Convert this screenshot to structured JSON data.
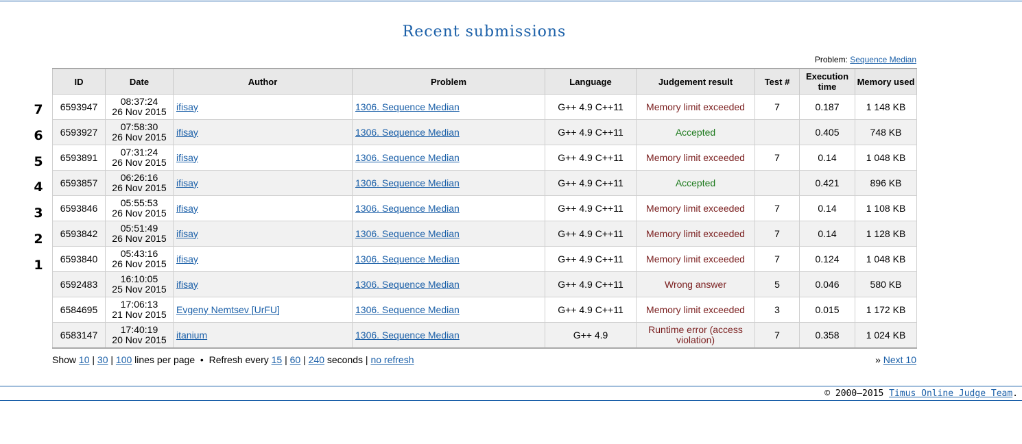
{
  "title": "Recent submissions",
  "problem_filter": {
    "label": "Problem:",
    "link": "Sequence Median"
  },
  "columns": [
    "ID",
    "Date",
    "Author",
    "Problem",
    "Language",
    "Judgement result",
    "Test #",
    "Execution time",
    "Memory used"
  ],
  "rows": [
    {
      "annot": "7",
      "id": "6593947",
      "time": "08:37:24",
      "date": "26 Nov 2015",
      "author": "ifisay",
      "problem": "1306. Sequence Median",
      "language": "G++ 4.9 C++11",
      "result": "Memory limit exceeded",
      "result_type": "mle",
      "test": "7",
      "exec": "0.187",
      "memory": "1 148 KB"
    },
    {
      "annot": "6",
      "id": "6593927",
      "time": "07:58:30",
      "date": "26 Nov 2015",
      "author": "ifisay",
      "problem": "1306. Sequence Median",
      "language": "G++ 4.9 C++11",
      "result": "Accepted",
      "result_type": "ac",
      "test": "",
      "exec": "0.405",
      "memory": "748 KB"
    },
    {
      "annot": "5",
      "id": "6593891",
      "time": "07:31:24",
      "date": "26 Nov 2015",
      "author": "ifisay",
      "problem": "1306. Sequence Median",
      "language": "G++ 4.9 C++11",
      "result": "Memory limit exceeded",
      "result_type": "mle",
      "test": "7",
      "exec": "0.14",
      "memory": "1 048 KB"
    },
    {
      "annot": "4",
      "id": "6593857",
      "time": "06:26:16",
      "date": "26 Nov 2015",
      "author": "ifisay",
      "problem": "1306. Sequence Median",
      "language": "G++ 4.9 C++11",
      "result": "Accepted",
      "result_type": "ac",
      "test": "",
      "exec": "0.421",
      "memory": "896 KB"
    },
    {
      "annot": "3",
      "id": "6593846",
      "time": "05:55:53",
      "date": "26 Nov 2015",
      "author": "ifisay",
      "problem": "1306. Sequence Median",
      "language": "G++ 4.9 C++11",
      "result": "Memory limit exceeded",
      "result_type": "mle",
      "test": "7",
      "exec": "0.14",
      "memory": "1 108 KB"
    },
    {
      "annot": "2",
      "id": "6593842",
      "time": "05:51:49",
      "date": "26 Nov 2015",
      "author": "ifisay",
      "problem": "1306. Sequence Median",
      "language": "G++ 4.9 C++11",
      "result": "Memory limit exceeded",
      "result_type": "mle",
      "test": "7",
      "exec": "0.14",
      "memory": "1 128 KB"
    },
    {
      "annot": "1",
      "id": "6593840",
      "time": "05:43:16",
      "date": "26 Nov 2015",
      "author": "ifisay",
      "problem": "1306. Sequence Median",
      "language": "G++ 4.9 C++11",
      "result": "Memory limit exceeded",
      "result_type": "mle",
      "test": "7",
      "exec": "0.124",
      "memory": "1 048 KB"
    },
    {
      "annot": "",
      "id": "6592483",
      "time": "16:10:05",
      "date": "25 Nov 2015",
      "author": "ifisay",
      "problem": "1306. Sequence Median",
      "language": "G++ 4.9 C++11",
      "result": "Wrong answer",
      "result_type": "wa",
      "test": "5",
      "exec": "0.046",
      "memory": "580 KB"
    },
    {
      "annot": "",
      "id": "6584695",
      "time": "17:06:13",
      "date": "21 Nov 2015",
      "author": "Evgeny Nemtsev [UrFU]",
      "problem": "1306. Sequence Median",
      "language": "G++ 4.9 C++11",
      "result": "Memory limit exceeded",
      "result_type": "mle",
      "test": "3",
      "exec": "0.015",
      "memory": "1 172 KB"
    },
    {
      "annot": "",
      "id": "6583147",
      "time": "17:40:19",
      "date": "20 Nov 2015",
      "author": "itanium",
      "problem": "1306. Sequence Median",
      "language": "G++ 4.9",
      "result": "Runtime error (access violation)",
      "result_type": "re",
      "test": "7",
      "exec": "0.358",
      "memory": "1 024 KB"
    }
  ],
  "pager": {
    "show": "Show",
    "count_options": [
      "10",
      "30",
      "100"
    ],
    "lines_per_page": "lines per page",
    "bullet": "•",
    "refresh_every": "Refresh every",
    "refresh_options": [
      "15",
      "60",
      "240"
    ],
    "seconds": "seconds",
    "no_refresh": "no refresh",
    "next_prefix": "»",
    "next": "Next 10"
  },
  "footer": {
    "copyright": "© 2000–2015",
    "team": "Timus Online Judge Team",
    "period": "."
  },
  "colors": {
    "link": "#1a5fa8",
    "accepted": "#1d7a1d",
    "rejected": "#7a1e1e"
  }
}
